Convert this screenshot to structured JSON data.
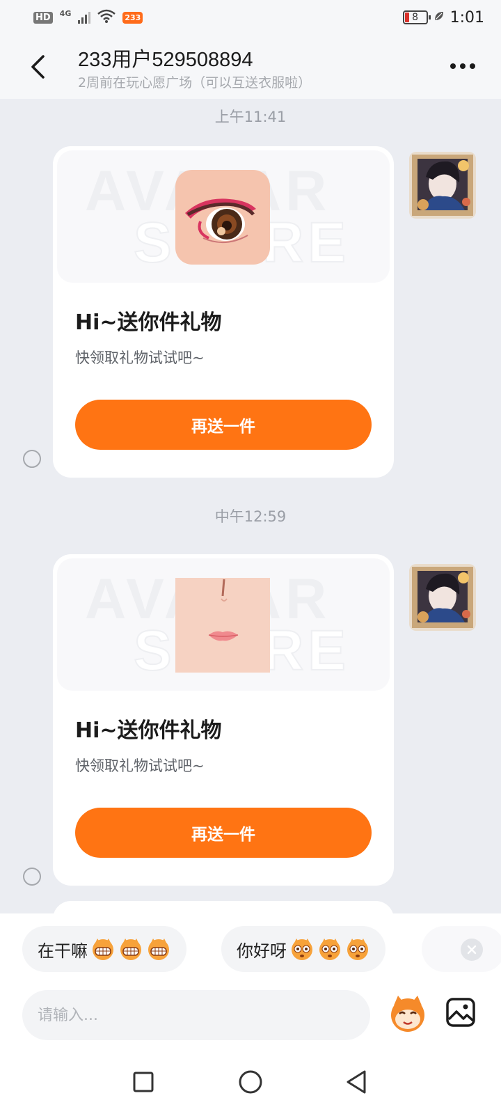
{
  "status_bar": {
    "network_badge": "HD",
    "signal_type": "4G",
    "app_badge": "233",
    "battery_level": "8",
    "time": "1:01",
    "icons": [
      "signal-icon",
      "wifi-icon",
      "battery-icon",
      "leaf-icon"
    ]
  },
  "header": {
    "title": "233用户529508894",
    "subtitle": "2周前在玩心愿广场（可以互送衣服啦）"
  },
  "messages": [
    {
      "time": "上午11:41",
      "gift_title": "Hi~送你件礼物",
      "gift_desc": "快领取礼物试试吧~",
      "button_label": "再送一件",
      "item": "eye-makeup"
    },
    {
      "time": "中午12:59",
      "gift_title": "Hi~送你件礼物",
      "gift_desc": "快领取礼物试试吧~",
      "button_label": "再送一件",
      "item": "lip-makeup"
    }
  ],
  "quick_replies": [
    {
      "label": "在干嘛"
    },
    {
      "label": "你好呀"
    }
  ],
  "input": {
    "placeholder": "请输入..."
  },
  "colors": {
    "accent": "#ff7413",
    "background": "#ebedf2",
    "card": "#ffffff"
  }
}
